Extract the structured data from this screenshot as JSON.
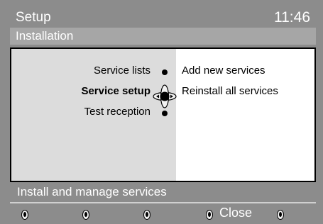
{
  "header": {
    "title": "Setup",
    "time": "11:46"
  },
  "subheader": {
    "title": "Installation"
  },
  "menu": {
    "items": [
      {
        "label": "Service lists"
      },
      {
        "label": "Service setup"
      },
      {
        "label": "Test reception"
      }
    ]
  },
  "options": [
    {
      "label": "Add new services"
    },
    {
      "label": "Reinstall all services"
    }
  ],
  "status": {
    "text": "Install and manage services"
  },
  "softkeys": {
    "close_label": "Close"
  }
}
